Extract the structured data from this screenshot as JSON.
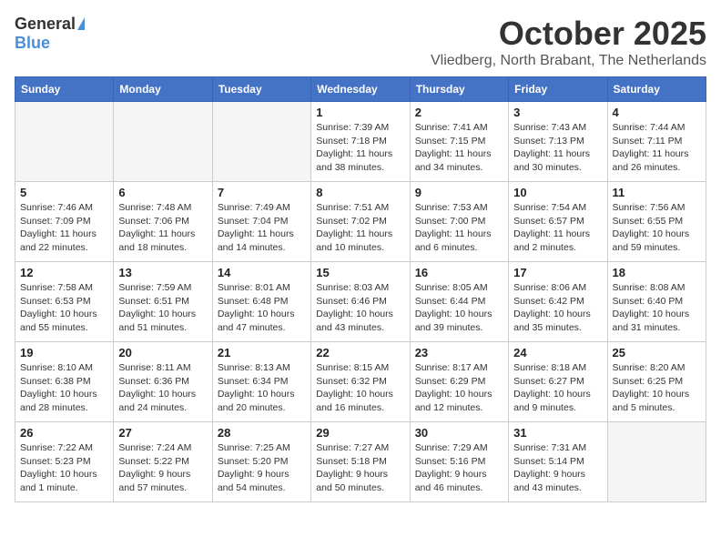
{
  "logo": {
    "general": "General",
    "blue": "Blue"
  },
  "title": "October 2025",
  "location": "Vliedberg, North Brabant, The Netherlands",
  "weekdays": [
    "Sunday",
    "Monday",
    "Tuesday",
    "Wednesday",
    "Thursday",
    "Friday",
    "Saturday"
  ],
  "weeks": [
    [
      {
        "day": "",
        "info": ""
      },
      {
        "day": "",
        "info": ""
      },
      {
        "day": "",
        "info": ""
      },
      {
        "day": "1",
        "info": "Sunrise: 7:39 AM\nSunset: 7:18 PM\nDaylight: 11 hours\nand 38 minutes."
      },
      {
        "day": "2",
        "info": "Sunrise: 7:41 AM\nSunset: 7:15 PM\nDaylight: 11 hours\nand 34 minutes."
      },
      {
        "day": "3",
        "info": "Sunrise: 7:43 AM\nSunset: 7:13 PM\nDaylight: 11 hours\nand 30 minutes."
      },
      {
        "day": "4",
        "info": "Sunrise: 7:44 AM\nSunset: 7:11 PM\nDaylight: 11 hours\nand 26 minutes."
      }
    ],
    [
      {
        "day": "5",
        "info": "Sunrise: 7:46 AM\nSunset: 7:09 PM\nDaylight: 11 hours\nand 22 minutes."
      },
      {
        "day": "6",
        "info": "Sunrise: 7:48 AM\nSunset: 7:06 PM\nDaylight: 11 hours\nand 18 minutes."
      },
      {
        "day": "7",
        "info": "Sunrise: 7:49 AM\nSunset: 7:04 PM\nDaylight: 11 hours\nand 14 minutes."
      },
      {
        "day": "8",
        "info": "Sunrise: 7:51 AM\nSunset: 7:02 PM\nDaylight: 11 hours\nand 10 minutes."
      },
      {
        "day": "9",
        "info": "Sunrise: 7:53 AM\nSunset: 7:00 PM\nDaylight: 11 hours\nand 6 minutes."
      },
      {
        "day": "10",
        "info": "Sunrise: 7:54 AM\nSunset: 6:57 PM\nDaylight: 11 hours\nand 2 minutes."
      },
      {
        "day": "11",
        "info": "Sunrise: 7:56 AM\nSunset: 6:55 PM\nDaylight: 10 hours\nand 59 minutes."
      }
    ],
    [
      {
        "day": "12",
        "info": "Sunrise: 7:58 AM\nSunset: 6:53 PM\nDaylight: 10 hours\nand 55 minutes."
      },
      {
        "day": "13",
        "info": "Sunrise: 7:59 AM\nSunset: 6:51 PM\nDaylight: 10 hours\nand 51 minutes."
      },
      {
        "day": "14",
        "info": "Sunrise: 8:01 AM\nSunset: 6:48 PM\nDaylight: 10 hours\nand 47 minutes."
      },
      {
        "day": "15",
        "info": "Sunrise: 8:03 AM\nSunset: 6:46 PM\nDaylight: 10 hours\nand 43 minutes."
      },
      {
        "day": "16",
        "info": "Sunrise: 8:05 AM\nSunset: 6:44 PM\nDaylight: 10 hours\nand 39 minutes."
      },
      {
        "day": "17",
        "info": "Sunrise: 8:06 AM\nSunset: 6:42 PM\nDaylight: 10 hours\nand 35 minutes."
      },
      {
        "day": "18",
        "info": "Sunrise: 8:08 AM\nSunset: 6:40 PM\nDaylight: 10 hours\nand 31 minutes."
      }
    ],
    [
      {
        "day": "19",
        "info": "Sunrise: 8:10 AM\nSunset: 6:38 PM\nDaylight: 10 hours\nand 28 minutes."
      },
      {
        "day": "20",
        "info": "Sunrise: 8:11 AM\nSunset: 6:36 PM\nDaylight: 10 hours\nand 24 minutes."
      },
      {
        "day": "21",
        "info": "Sunrise: 8:13 AM\nSunset: 6:34 PM\nDaylight: 10 hours\nand 20 minutes."
      },
      {
        "day": "22",
        "info": "Sunrise: 8:15 AM\nSunset: 6:32 PM\nDaylight: 10 hours\nand 16 minutes."
      },
      {
        "day": "23",
        "info": "Sunrise: 8:17 AM\nSunset: 6:29 PM\nDaylight: 10 hours\nand 12 minutes."
      },
      {
        "day": "24",
        "info": "Sunrise: 8:18 AM\nSunset: 6:27 PM\nDaylight: 10 hours\nand 9 minutes."
      },
      {
        "day": "25",
        "info": "Sunrise: 8:20 AM\nSunset: 6:25 PM\nDaylight: 10 hours\nand 5 minutes."
      }
    ],
    [
      {
        "day": "26",
        "info": "Sunrise: 7:22 AM\nSunset: 5:23 PM\nDaylight: 10 hours\nand 1 minute."
      },
      {
        "day": "27",
        "info": "Sunrise: 7:24 AM\nSunset: 5:22 PM\nDaylight: 9 hours\nand 57 minutes."
      },
      {
        "day": "28",
        "info": "Sunrise: 7:25 AM\nSunset: 5:20 PM\nDaylight: 9 hours\nand 54 minutes."
      },
      {
        "day": "29",
        "info": "Sunrise: 7:27 AM\nSunset: 5:18 PM\nDaylight: 9 hours\nand 50 minutes."
      },
      {
        "day": "30",
        "info": "Sunrise: 7:29 AM\nSunset: 5:16 PM\nDaylight: 9 hours\nand 46 minutes."
      },
      {
        "day": "31",
        "info": "Sunrise: 7:31 AM\nSunset: 5:14 PM\nDaylight: 9 hours\nand 43 minutes."
      },
      {
        "day": "",
        "info": ""
      }
    ]
  ]
}
